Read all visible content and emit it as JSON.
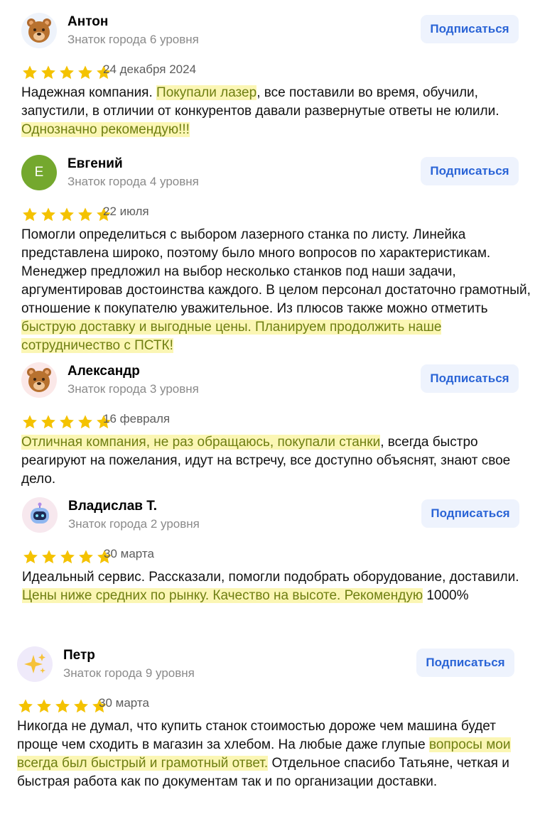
{
  "subscribe_label": "Подписаться",
  "colors": {
    "star": "#f4c200",
    "highlight_bg": "#fbf6b4",
    "highlight_text": "#6f7f12",
    "button_text": "#2a64d6"
  },
  "reviews": [
    {
      "name": "Антон",
      "level": "Знаток города 6 уровня",
      "date": "24 декабря 2024",
      "avatar_icon": "bear-emoji-icon",
      "rating": 5,
      "text": {
        "p1": "Надежная компания. ",
        "h1": "Покупали лазер",
        "p2": ", все поставили во время, обучили, запустили, в отличии от конкурентов давали развернутые ответы не юлили. ",
        "h2": "Однозначно рекомендую!!!"
      }
    },
    {
      "name": "Евгений",
      "level": "Знаток города 4 уровня",
      "date": "22 июля",
      "avatar_letter": "Е",
      "rating": 5,
      "text": {
        "p1": "Помогли определиться с выбором лазерного станка по листу. Линейка представлена широко, поэтому было много вопросов по характеристикам. Менеджер предложил на выбор несколько станков под наши задачи, аргументировав достоинства каждого. В целом персонал достаточно грамотный, отношение к покупателю уважительное. Из плюсов также можно отметить ",
        "h1": "быструю доставку и выгодные цены. Планируем продолжить наше сотрудничество с ПСТК!"
      }
    },
    {
      "name": "Александр",
      "level": "Знаток города 3 уровня",
      "date": "16 февраля",
      "avatar_icon": "bear-emoji-icon",
      "rating": 5,
      "text": {
        "h1": "Отличная компания, не раз обращаюсь, покупали станки",
        "p1": ", всегда быстро реагируют на пожелания, идут на встречу, все доступно объяснят, знают свое дело."
      }
    },
    {
      "name": "Владислав Т.",
      "level": "Знаток города 2 уровня",
      "date": "30 марта",
      "avatar_icon": "robot-icon",
      "rating": 5,
      "text": {
        "p1": "Идеальный сервис. Рассказали, помогли подобрать оборудование, доставили. ",
        "h1": "Цены ниже средних по рынку. Качество на высоте. Рекомендую",
        "p2": " 1000%"
      }
    },
    {
      "name": "Петр",
      "level": "Знаток города 9 уровня",
      "date": "30 марта",
      "avatar_icon": "sparkles-icon",
      "rating": 5,
      "text": {
        "p1": "Никогда не думал, что купить станок стоимостью дороже чем машина будет проще чем сходить в магазин за хлебом. На любые даже глупые ",
        "h1": "вопросы мои всегда был быстрый и грамотный ответ.",
        "p2": " Отдельное спасибо Татьяне, четкая и быстрая работа как по документам так и по организации доставки."
      }
    }
  ]
}
